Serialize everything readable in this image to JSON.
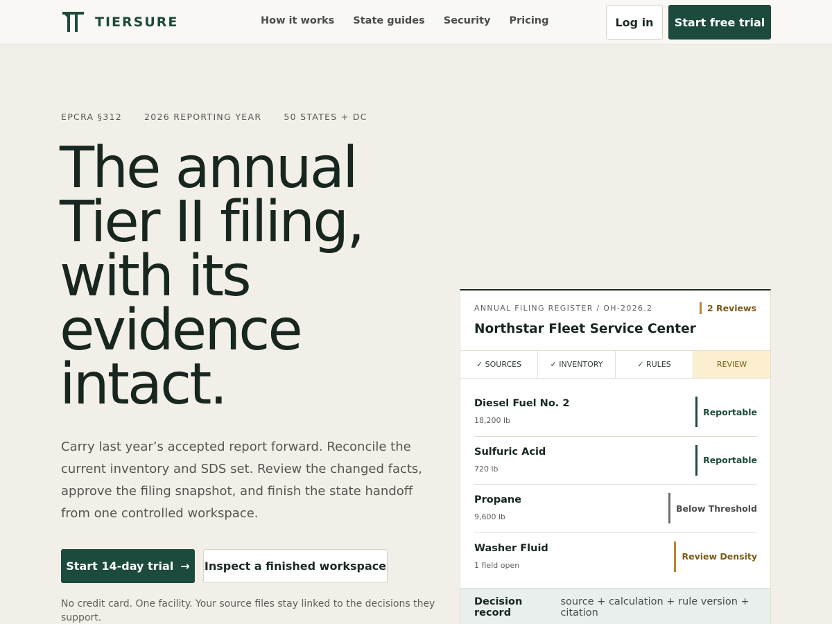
{
  "nav": {
    "logo_text": "TIERSURE",
    "links": [
      "How it works",
      "State guides",
      "Security",
      "Pricing"
    ],
    "login_label": "Log in",
    "trial_label": "Start free trial"
  },
  "hero": {
    "eyebrow": [
      "EPCRA §312",
      "2026 REPORTING YEAR",
      "50 STATES + DC"
    ],
    "headline_lines": [
      "The annual",
      "Tier II filing,",
      "with its",
      "evidence",
      "intact."
    ],
    "lede": "Carry last year’s accepted report forward. Reconcile the current inventory and SDS set. Review the changed facts, approve the filing snapshot, and finish the state handoff from one controlled workspace.",
    "primary_cta": "Start 14-day trial",
    "secondary_cta": "Inspect a finished workspace",
    "footnote": "No credit card. One facility. Your source files stay linked to the decisions they support."
  },
  "register": {
    "eyebrow": "ANNUAL FILING REGISTER / OH-2026.2",
    "badge": "2 Reviews",
    "facility": "Northstar Fleet Service Center",
    "steps": [
      {
        "label": "✓ SOURCES",
        "active": false
      },
      {
        "label": "✓ INVENTORY",
        "active": false
      },
      {
        "label": "✓ RULES",
        "active": false
      },
      {
        "label": "REVIEW",
        "active": true
      }
    ],
    "rows": [
      {
        "name": "Diesel Fuel No. 2",
        "sub": "18,200 lb",
        "status": "Reportable",
        "tone": "good"
      },
      {
        "name": "Sulfuric Acid",
        "sub": "720 lb",
        "status": "Reportable",
        "tone": "good"
      },
      {
        "name": "Propane",
        "sub": "9,600 lb",
        "status": "Below Threshold",
        "tone": "neutral"
      },
      {
        "name": "Washer Fluid",
        "sub": "1 field open",
        "status": "Review Density",
        "tone": "warn"
      }
    ],
    "decision_label": "Decision record",
    "decision_text": "source + calculation + rule version + citation"
  },
  "colors": {
    "brand_green": "#1c4a3c",
    "warning_amber": "#b8862a",
    "page_background": "#f2efe8"
  }
}
